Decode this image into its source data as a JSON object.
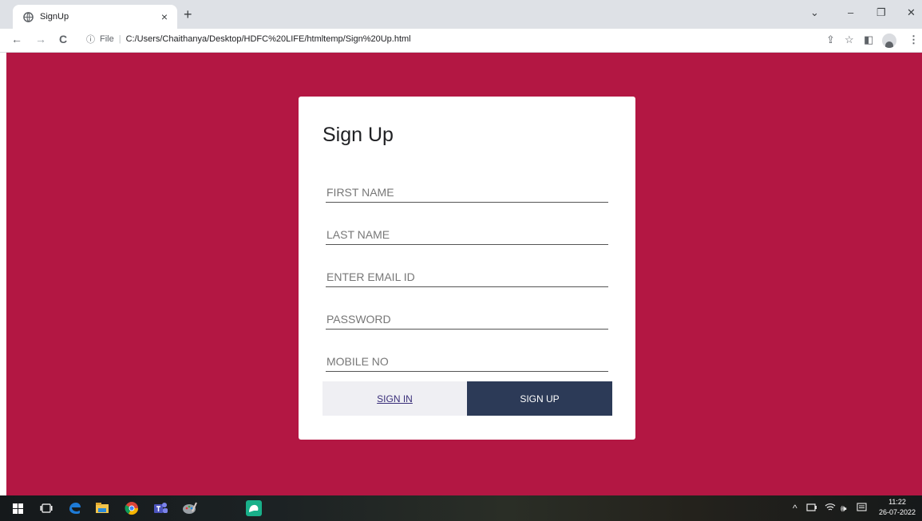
{
  "browser": {
    "tab_title": "SignUp",
    "tab_close": "×",
    "new_tab": "+",
    "window_controls": {
      "dropdown": "⌄",
      "minimize": "–",
      "restore": "❐",
      "close": "✕"
    },
    "nav": {
      "back": "←",
      "forward": "→",
      "reload": "C"
    },
    "address": {
      "info_icon": "ⓘ",
      "scheme_label": "File",
      "separator": "|",
      "path": "C:/Users/Chaithanya/Desktop/HDFC%20LIFE/htmltemp/Sign%20Up.html"
    },
    "toolbar_icons": {
      "share": "⇪",
      "bookmark": "☆",
      "sidepanel": "◧",
      "menu": "⋮"
    }
  },
  "page": {
    "background": "#b31743",
    "form": {
      "title": "Sign Up",
      "fields": [
        {
          "name": "first-name",
          "placeholder": "FIRST NAME",
          "type": "text"
        },
        {
          "name": "last-name",
          "placeholder": "LAST NAME",
          "type": "text"
        },
        {
          "name": "email",
          "placeholder": "ENTER EMAIL ID",
          "type": "email"
        },
        {
          "name": "password",
          "placeholder": "PASSWORD",
          "type": "password"
        },
        {
          "name": "mobile",
          "placeholder": "MOBILE NO",
          "type": "tel"
        }
      ],
      "sign_in_label": "SIGN IN",
      "sign_up_label": "SIGN UP",
      "sign_up_color": "#2c3a57"
    }
  },
  "taskbar": {
    "apps": [
      "windows-start-icon",
      "task-view-icon",
      "edge-icon",
      "file-explorer-icon",
      "chrome-icon",
      "teams-icon",
      "paint-icon",
      "app-icon"
    ],
    "tray": {
      "chevron": "^",
      "volume": "🕪"
    },
    "clock": {
      "time": "11:22",
      "date": "26-07-2022"
    }
  }
}
